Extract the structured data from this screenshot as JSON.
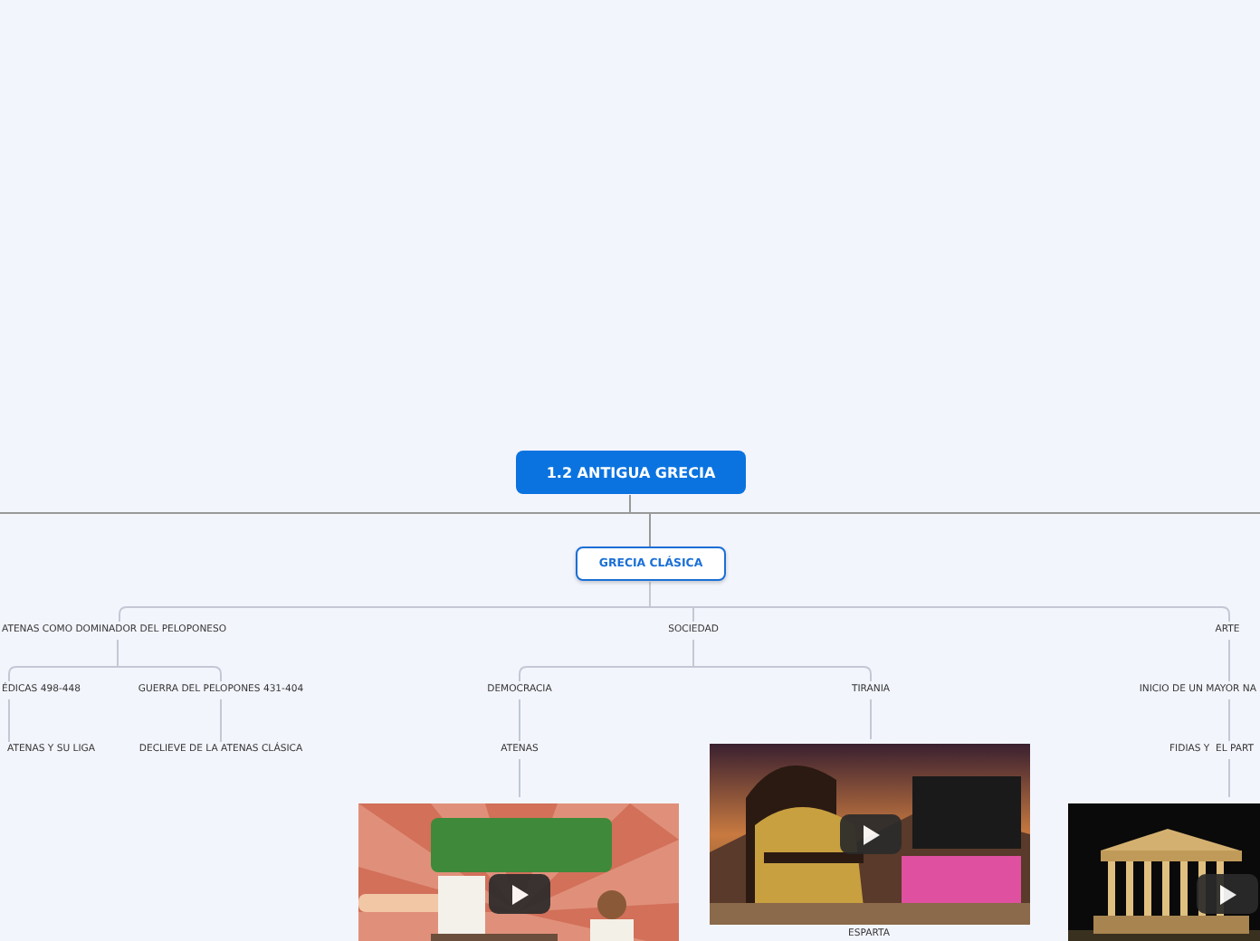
{
  "mind_map": {
    "title": "1.2 ANTIGUA GRECIA",
    "children": [
      {
        "kind": "main",
        "label": "GRECIA CLÁSICA",
        "children": [
          {
            "kind": "topic",
            "label": "ATENAS COMO DOMINADOR DEL PELOPONESO",
            "children": [
              {
                "kind": "topic",
                "label": "ÉDICAS 498-448",
                "children": [
                  {
                    "kind": "topic",
                    "label": "ATENAS Y SU LIGA"
                  }
                ]
              },
              {
                "kind": "topic",
                "label": "GUERRA DEL PELOPONES 431-404",
                "children": [
                  {
                    "kind": "topic",
                    "label": "DECLIEVE DE LA ATENAS CLÁSICA"
                  }
                ]
              }
            ]
          },
          {
            "kind": "topic",
            "label": "SOCIEDAD",
            "children": [
              {
                "kind": "topic",
                "label": "DEMOCRACIA",
                "children": [
                  {
                    "kind": "topic",
                    "label": "ATENAS",
                    "children": [
                      {
                        "kind": "video"
                      }
                    ]
                  }
                ]
              },
              {
                "kind": "topic",
                "label": "TIRANIA",
                "children": [
                  {
                    "kind": "video",
                    "label": "ESPARTA"
                  }
                ]
              }
            ]
          },
          {
            "kind": "topic",
            "label": "ARTE",
            "children": [
              {
                "kind": "topic",
                "label": "INICIO DE UN MAYOR NA",
                "children": [
                  {
                    "kind": "topic",
                    "label": "FIDIAS Y  EL PART",
                    "children": [
                      {
                        "kind": "video"
                      }
                    ]
                  }
                ]
              }
            ]
          }
        ]
      }
    ]
  }
}
